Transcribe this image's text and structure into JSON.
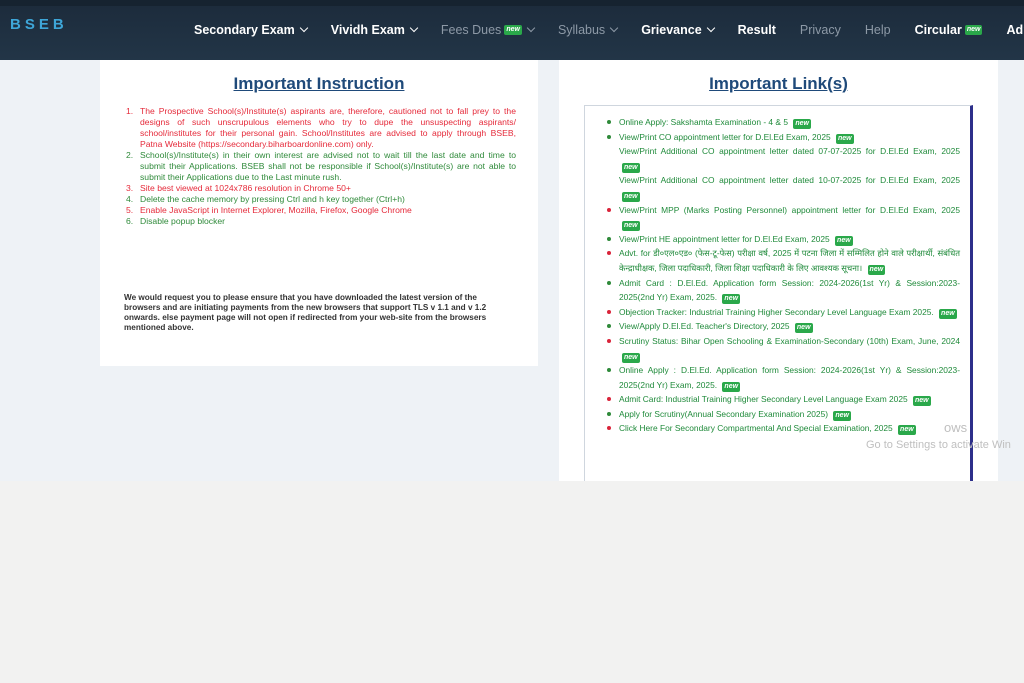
{
  "nav": {
    "logo": "BSEB",
    "new_label": "new",
    "items": [
      {
        "label": "Secondary Exam",
        "caret": true,
        "dim": false,
        "new": false
      },
      {
        "label": "Vividh Exam",
        "caret": true,
        "dim": false,
        "new": false
      },
      {
        "label": "Fees Dues",
        "caret": true,
        "dim": true,
        "new": true
      },
      {
        "label": "Syllabus",
        "caret": true,
        "dim": true,
        "new": false
      },
      {
        "label": "Grievance",
        "caret": true,
        "dim": false,
        "new": false
      },
      {
        "label": "Result",
        "caret": false,
        "dim": false,
        "new": false
      },
      {
        "label": "Privacy",
        "caret": false,
        "dim": true,
        "new": false
      },
      {
        "label": "Help",
        "caret": false,
        "dim": true,
        "new": false
      },
      {
        "label": "Circular",
        "caret": false,
        "dim": false,
        "new": true
      },
      {
        "label": "Admin",
        "caret": false,
        "dim": false,
        "new": false
      }
    ]
  },
  "instructions": {
    "title": "Important Instruction",
    "items": [
      {
        "num": "1.",
        "text": "The Prospective School(s)/Institute(s) aspirants are, therefore, cautioned not to fall prey to the designs of such unscrupulous elements who try to dupe the unsuspecting aspirants/ school/institutes for their personal gain. School/Institutes are advised to apply through BSEB, Patna Website (https://secondary.biharboardonline.com) only.",
        "color": "red"
      },
      {
        "num": "2.",
        "text": "School(s)/Institute(s) in their own interest are advised not to wait till the last date and time to submit their Applications. BSEB shall not be responsible if School(s)/Institute(s) are not able to submit their Applications due to the Last minute rush.",
        "color": "green"
      },
      {
        "num": "3.",
        "text": "Site best viewed at 1024x786 resolution in Chrome 50+",
        "color": "red"
      },
      {
        "num": "4.",
        "text": "Delete the cache memory by pressing Ctrl and h key together (Ctrl+h)",
        "color": "green"
      },
      {
        "num": "5.",
        "text": "Enable JavaScript in Internet Explorer, Mozilla, Firefox, Google Chrome",
        "color": "red"
      },
      {
        "num": "6.",
        "text": "Disable popup blocker",
        "color": "green"
      }
    ],
    "notice": "We would request you to please ensure that you have downloaded the latest version of the browsers and are initiating payments from the new browsers that support TLS v 1.1 and v 1.2 onwards. else payment page will not open if redirected from your web-site from the browsers mentioned above."
  },
  "links": {
    "title": "Important Link(s)",
    "new_label": "new",
    "items": [
      {
        "text": "Online Apply: Sakshamta Examination - 4 & 5",
        "bullet": "green",
        "new": true
      },
      {
        "text": "View/Print CO appointment letter for D.El.Ed Exam, 2025",
        "bullet": "green",
        "new": true
      },
      {
        "text": "View/Print Additional CO appointment letter dated 07-07-2025 for D.El.Ed Exam, 2025",
        "bullet": "none",
        "new": true
      },
      {
        "text": "View/Print Additional CO appointment letter dated 10-07-2025 for D.El.Ed Exam, 2025",
        "bullet": "none",
        "new": true
      },
      {
        "text": "View/Print MPP (Marks Posting Personnel) appointment letter for D.El.Ed Exam, 2025",
        "bullet": "red",
        "new": true
      },
      {
        "text": "View/Print HE appointment letter for D.El.Ed Exam, 2025",
        "bullet": "green",
        "new": true
      },
      {
        "text": "Advt. for डी०एल०एड० (फेस-टू-फेस) परीक्षा वर्ष, 2025 में पटना जिला में सम्मिलित होने वाले परीक्षार्थी, संबंधित केन्द्राधीक्षक, जिला पदाधिकारी, जिला शिक्षा पदाधिकारी के लिए आवश्यक सूचना।",
        "bullet": "red",
        "new": true
      },
      {
        "text": "Admit Card : D.El.Ed. Application form Session: 2024-2026(1st Yr) & Session:2023-2025(2nd Yr) Exam, 2025.",
        "bullet": "green",
        "new": true
      },
      {
        "text": "Objection Tracker: Industrial Training Higher Secondary Level Language Exam 2025.",
        "bullet": "red",
        "new": true
      },
      {
        "text": "View/Apply D.El.Ed. Teacher's Directory, 2025",
        "bullet": "green",
        "new": true
      },
      {
        "text": "Scrutiny Status: Bihar Open Schooling & Examination-Secondary (10th) Exam, June, 2024",
        "bullet": "red",
        "new": true
      },
      {
        "text": "Online Apply : D.El.Ed. Application form Session: 2024-2026(1st Yr) & Session:2023-2025(2nd Yr) Exam, 2025.",
        "bullet": "green",
        "new": true
      },
      {
        "text": "Admit Card: Industrial Training Higher Secondary Level Language Exam 2025",
        "bullet": "red",
        "new": true
      },
      {
        "text": "Apply for Scrutiny(Annual Secondary Examination 2025)",
        "bullet": "green",
        "new": true
      },
      {
        "text": "Click Here For Secondary Compartmental And Special Examination, 2025",
        "bullet": "red",
        "new": true
      }
    ]
  },
  "watermark": {
    "line1": "ows",
    "line2": "Go to Settings to activate Win"
  }
}
